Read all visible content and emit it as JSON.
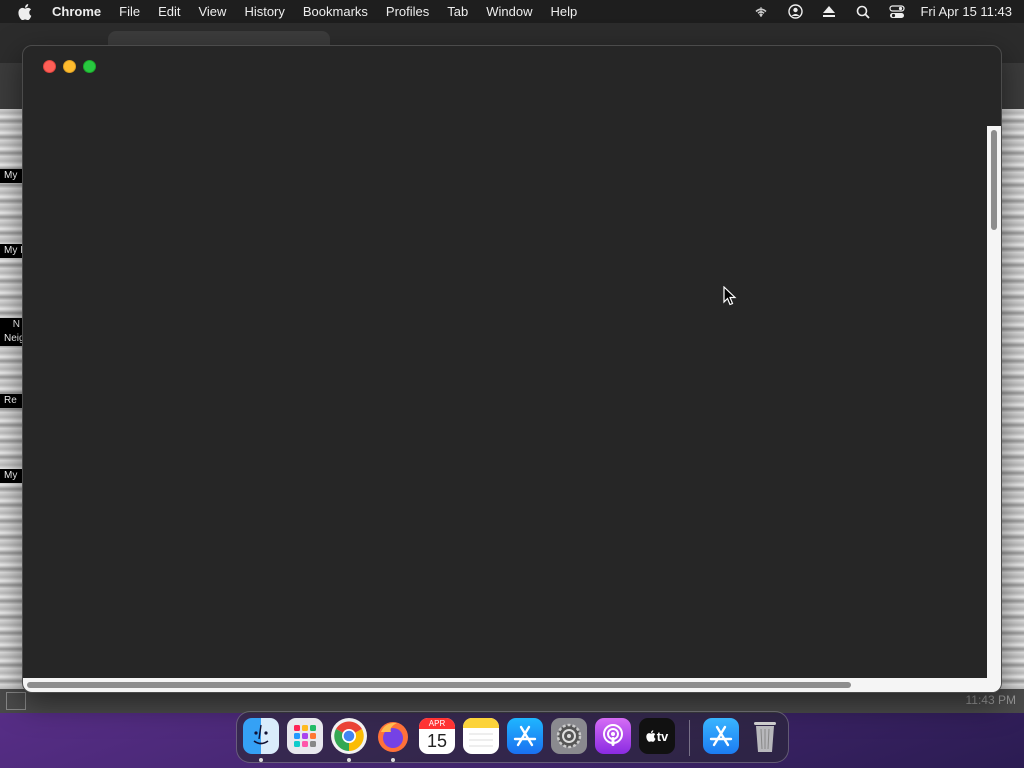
{
  "menubar": {
    "app_name": "Chrome",
    "items": [
      "File",
      "Edit",
      "View",
      "History",
      "Bookmarks",
      "Profiles",
      "Tab",
      "Window",
      "Help"
    ],
    "clock": "Fri Apr 15  11:43"
  },
  "background_window": {
    "strip_labels": [
      "My",
      "My I",
      "N",
      "Neig",
      "Re",
      "My"
    ],
    "status_time": "11:43 PM"
  },
  "dock": {
    "calendar_month": "APR",
    "calendar_day": "15",
    "tv_label": "tv"
  },
  "colors": {
    "window_bg": "#262626",
    "close": "#fe5f57",
    "minimize": "#febc2e",
    "maximize": "#28c840"
  }
}
